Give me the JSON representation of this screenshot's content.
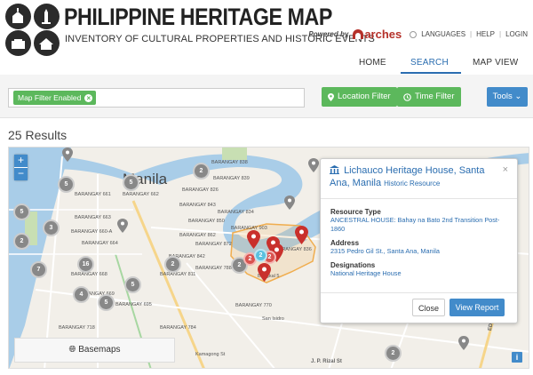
{
  "header": {
    "title": "PHILIPPINE HERITAGE MAP",
    "subtitle": "INVENTORY OF CULTURAL PROPERTIES AND HISTORIC EVENTS",
    "powered_by": "Powered by",
    "arches_brand": "arches",
    "languages": "LANGUAGES",
    "sep1": "|",
    "help": "HELP",
    "sep2": "|",
    "login": "LOGIN"
  },
  "nav": {
    "tabs": [
      "HOME",
      "SEARCH",
      "MAP VIEW"
    ],
    "active": "SEARCH"
  },
  "filters": {
    "chip_label": "Map Filter Enabled",
    "location_filter": "Location Filter",
    "time_filter": "Time Filter",
    "tools": "Tools"
  },
  "results": {
    "count_label": "25 Results"
  },
  "map": {
    "city_label": "Manila",
    "basemaps_label": "Basemaps",
    "info_label": "i",
    "street_labels": [
      "BARANGAY 838",
      "BARANGAY 839",
      "BARANGAY 661",
      "BARANGAY 662",
      "BARANGAY 663",
      "BARANGAY 660-A",
      "BARANGAY 664",
      "BARANGAY 668",
      "BARANGAY 669",
      "BARANGAY 695",
      "BARANGAY 826",
      "BARANGAY 843",
      "BARANGAY 850",
      "BARANGAY 862",
      "BARANGAY 872",
      "BARANGAY 842",
      "BARANGAY 834",
      "BARANGAY 903",
      "BARANGAY 836",
      "BARANGAY 788",
      "BARANGAY 811",
      "BARANGAY 770",
      "BARANGAY 784",
      "BARANGAY 718",
      "Bangkal 5",
      "San Isidro",
      "Kamagong St"
    ],
    "road_labels": [
      "EDSA",
      "J. P. Rizal St"
    ],
    "clusters": [
      "5",
      "2",
      "5",
      "2",
      "3",
      "16",
      "2",
      "7",
      "4",
      "5",
      "5",
      "5",
      "2",
      "2",
      "2",
      "2",
      "2"
    ],
    "popup": {
      "title": "Lichauco Heritage House, Santa Ana, Manila",
      "type": "Historic Resource",
      "close_x": "×",
      "fields": [
        {
          "label": "Resource Type",
          "value": "ANCESTRAL HOUSE: Bahay na Bato 2nd Transition Post-1860"
        },
        {
          "label": "Address",
          "value": "2315 Pedro Gil St., Santa Ana, Manila"
        },
        {
          "label": "Designations",
          "value": "National Heritage House"
        }
      ],
      "close_button": "Close",
      "report_button": "View Report"
    }
  },
  "colors": {
    "accent_blue": "#428bca",
    "accent_green": "#5cb85c",
    "pin_red": "#c9302c",
    "polygon_orange": "#f0ad4e"
  }
}
